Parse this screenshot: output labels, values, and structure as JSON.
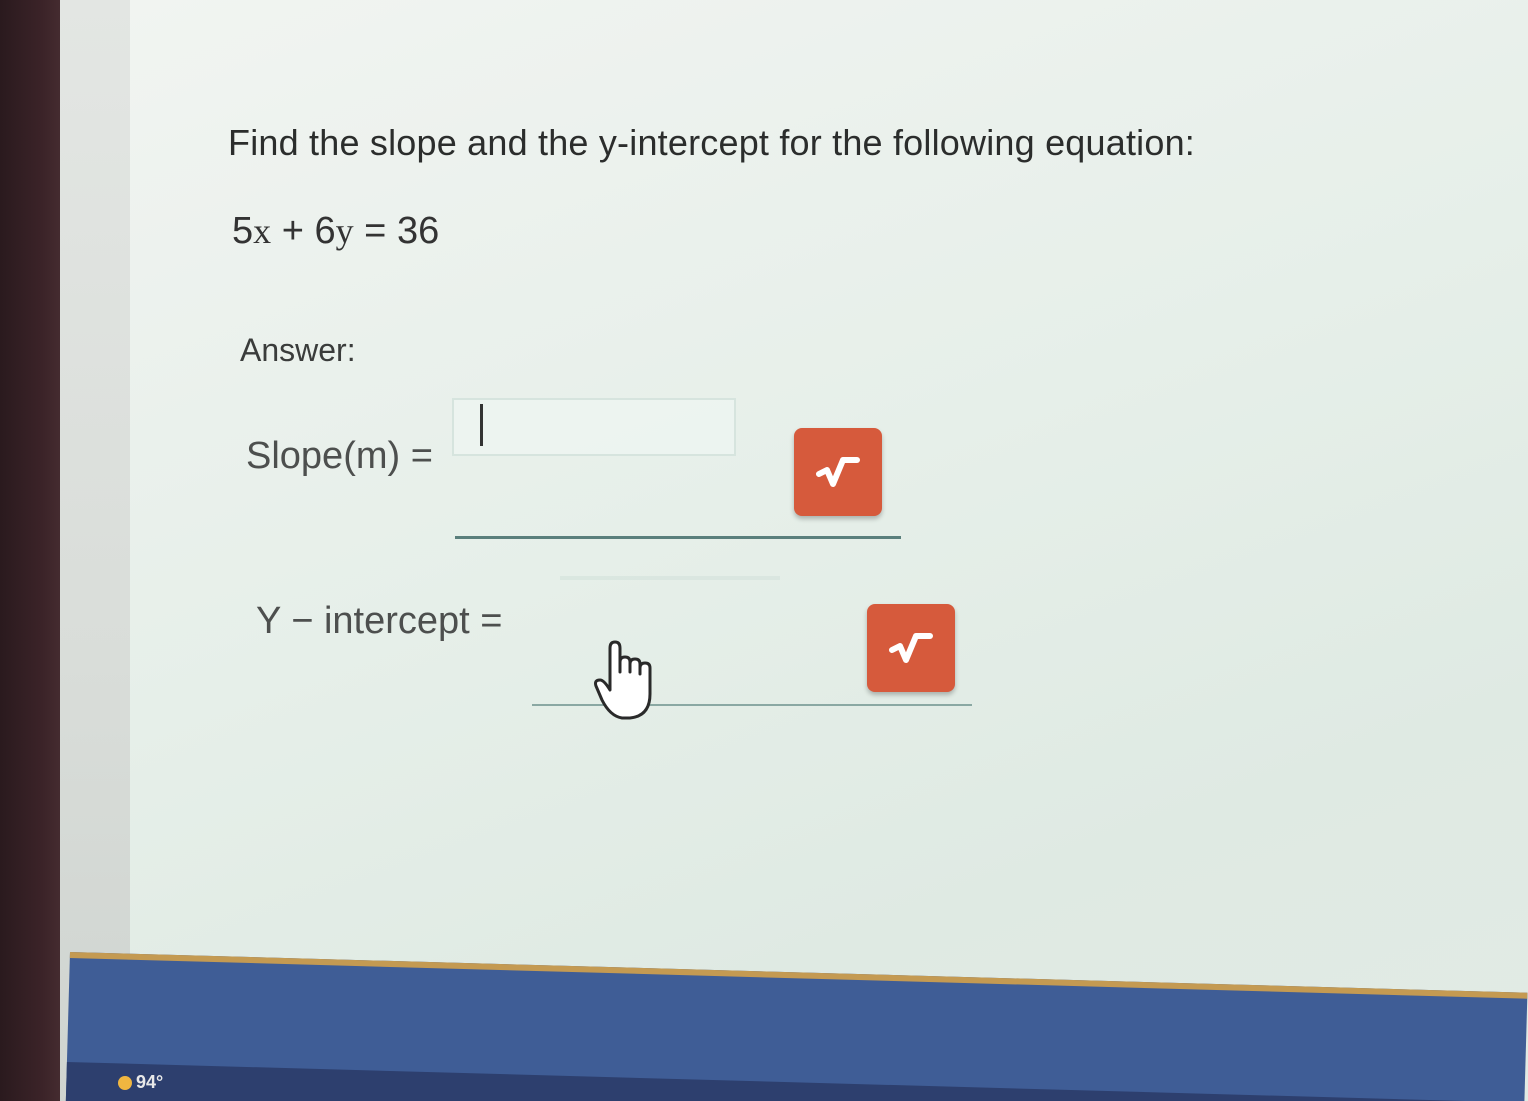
{
  "question": {
    "prompt": "Find the slope and the y-intercept for the following equation:",
    "equation": {
      "coef_x": "5",
      "var_x": "x",
      "plus": "+",
      "coef_y": "6",
      "var_y": "y",
      "equals": "=",
      "rhs": "36"
    }
  },
  "answer": {
    "label": "Answer:",
    "slope": {
      "label": "Slope(m) =",
      "value": ""
    },
    "y_intercept": {
      "label": "Y − intercept =",
      "value": ""
    }
  },
  "icons": {
    "math_button": "square-root-icon",
    "cursor": "hand-pointer-icon",
    "weather": "sun-icon"
  },
  "colors": {
    "math_button": "#d65a3c",
    "underline": "#5a7f7c",
    "taskbar": "#3f5d96"
  },
  "taskbar": {
    "temperature": "94°"
  }
}
